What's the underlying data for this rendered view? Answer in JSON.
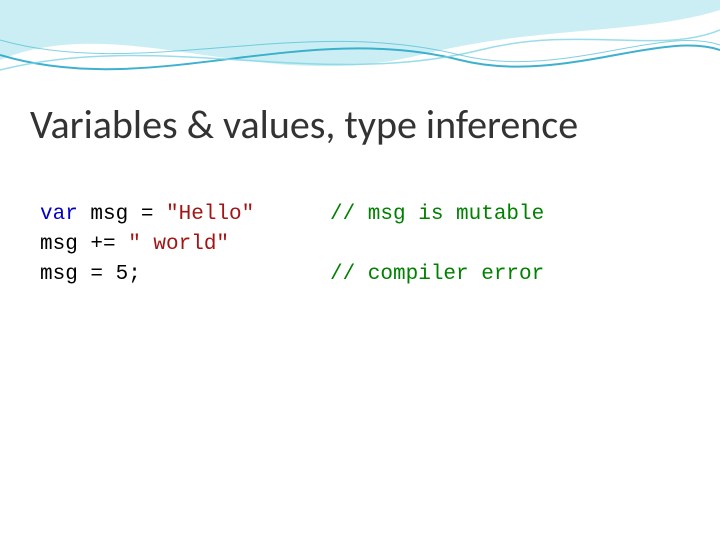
{
  "title": "Variables & values, type inference",
  "code": {
    "l1": {
      "kw": "var",
      "mid": " msg = ",
      "str": "\"Hello\"",
      "comment": "// msg is mutable"
    },
    "l2": {
      "mid": "msg += ",
      "str": "\" world\"",
      "comment": ""
    },
    "l3": {
      "text": "msg = 5;",
      "comment": "// compiler error"
    }
  }
}
